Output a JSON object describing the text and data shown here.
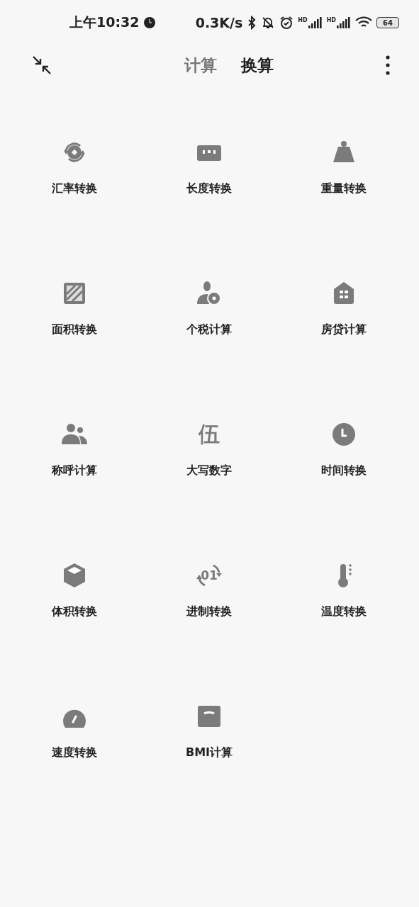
{
  "status_bar": {
    "time": "上午10:32",
    "speed": "0.3K/s",
    "signals": [
      {
        "label": "HD"
      },
      {
        "label": "HD"
      }
    ],
    "battery": "64"
  },
  "tabs": [
    {
      "label": "计算",
      "selected": false
    },
    {
      "label": "换算",
      "selected": true
    }
  ],
  "tools": [
    {
      "kind": "currency",
      "label": "汇率转换"
    },
    {
      "kind": "length",
      "label": "长度转换"
    },
    {
      "kind": "weight",
      "label": "重量转换"
    },
    {
      "kind": "area",
      "label": "面积转换"
    },
    {
      "kind": "tax",
      "label": "个税计算"
    },
    {
      "kind": "mortgage",
      "label": "房贷计算"
    },
    {
      "kind": "relatives",
      "label": "称呼计算"
    },
    {
      "kind": "glyph",
      "glyph": "伍",
      "label": "大写数字"
    },
    {
      "kind": "time",
      "label": "时间转换"
    },
    {
      "kind": "volume",
      "label": "体积转换"
    },
    {
      "kind": "radix",
      "glyph": "01",
      "label": "进制转换"
    },
    {
      "kind": "temperature",
      "label": "温度转换"
    },
    {
      "kind": "speed",
      "label": "速度转换"
    },
    {
      "kind": "bmi",
      "label": "BMI计算"
    }
  ]
}
